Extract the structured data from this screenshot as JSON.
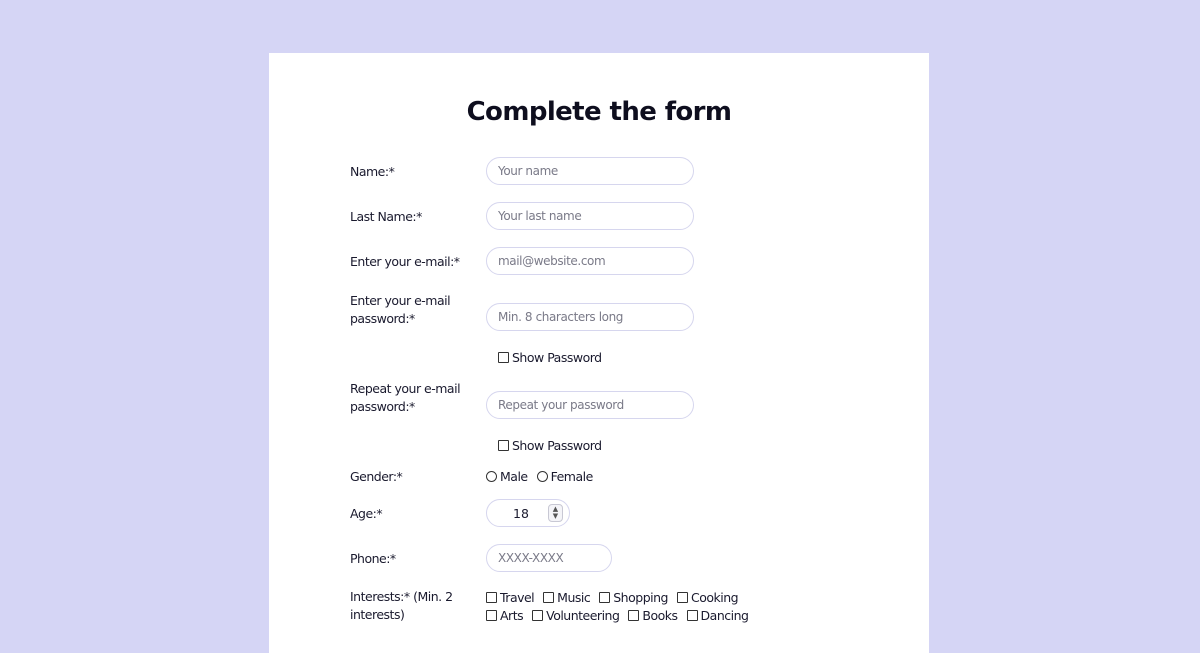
{
  "form": {
    "title": "Complete the form",
    "name": {
      "label": "Name:*",
      "placeholder": "Your name"
    },
    "last_name": {
      "label": "Last Name:*",
      "placeholder": "Your last name"
    },
    "email": {
      "label": "Enter your e-mail:*",
      "placeholder": "mail@website.com"
    },
    "password": {
      "label": "Enter your e-mail password:*",
      "placeholder": "Min. 8 characters long",
      "show_label": "Show Password"
    },
    "repeat_password": {
      "label": "Repeat your e-mail password:*",
      "placeholder": "Repeat your password",
      "show_label": "Show Password"
    },
    "gender": {
      "label": "Gender:*",
      "options": [
        "Male",
        "Female"
      ]
    },
    "age": {
      "label": "Age:*",
      "value": "18"
    },
    "phone": {
      "label": "Phone:*",
      "placeholder": "XXXX-XXXX"
    },
    "interests": {
      "label": "Interests:* (Min. 2 interests)",
      "row1": [
        "Travel",
        "Music",
        "Shopping",
        "Cooking"
      ],
      "row2": [
        "Arts",
        "Volunteering",
        "Books",
        "Dancing"
      ]
    }
  },
  "colors": {
    "background": "#d5d5f5",
    "card": "#ffffff",
    "field_border": "#d6d6ee"
  }
}
